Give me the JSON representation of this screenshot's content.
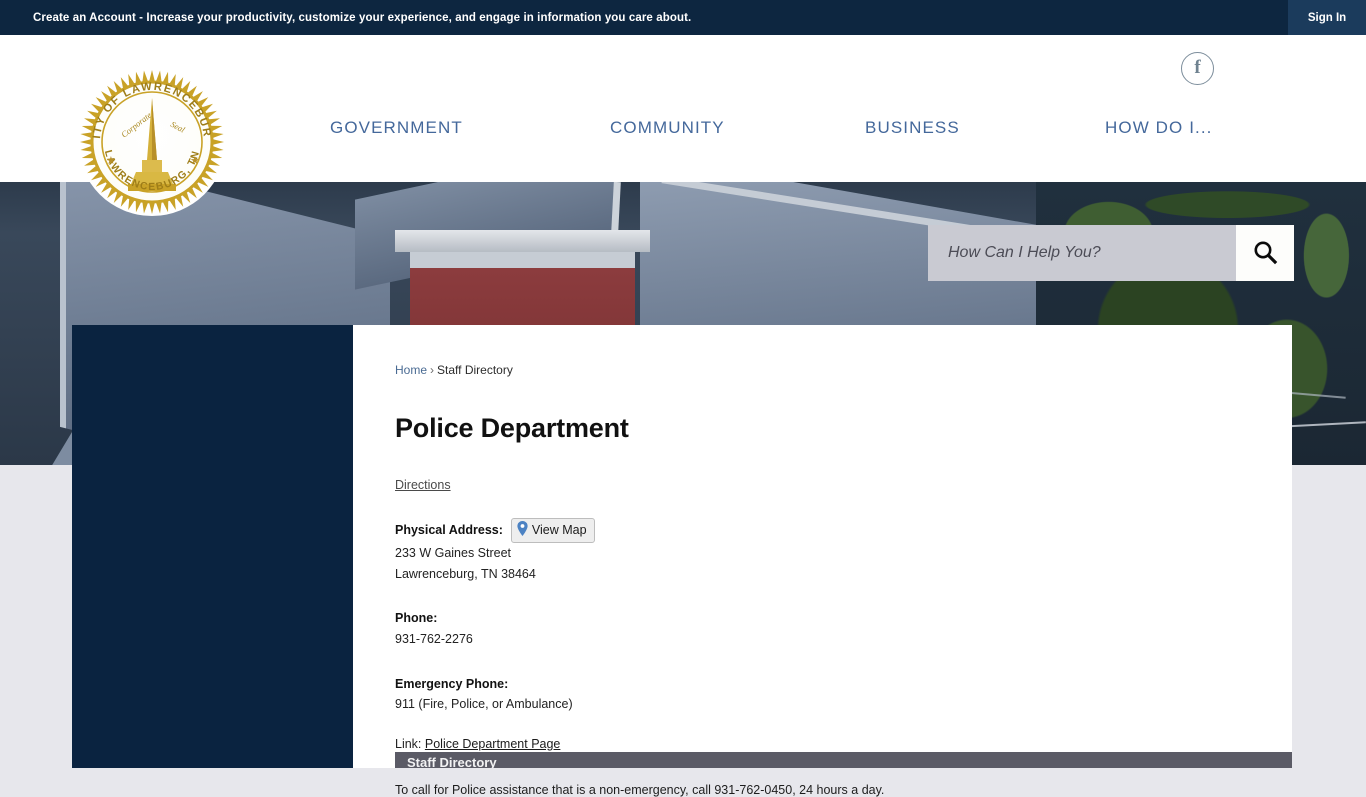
{
  "topbar": {
    "message": "Create an Account - Increase your productivity, customize your experience, and engage in information you care about.",
    "signin_label": "Sign In"
  },
  "header": {
    "logo": {
      "icon": "city-seal-logo",
      "top_arc_text": "CITY OF LAWRENCEBURG",
      "bottom_arc_text": "LAWRENCEBURG, TN",
      "script_left": "Corporate",
      "script_right": "Seal",
      "color": "#c9a227"
    },
    "social": [
      {
        "icon": "facebook-icon",
        "glyph": "f"
      }
    ],
    "nav": [
      {
        "label": "GOVERNMENT"
      },
      {
        "label": "COMMUNITY"
      },
      {
        "label": "BUSINESS"
      },
      {
        "label": "HOW DO I..."
      }
    ],
    "nav_color": "#44689b"
  },
  "search": {
    "placeholder": "How Can I Help You?",
    "value": "",
    "button_icon": "search-icon"
  },
  "breadcrumb": {
    "items": [
      {
        "label": "Home",
        "is_link": true
      },
      {
        "label": "Staff Directory",
        "is_link": false
      }
    ],
    "separator": "›"
  },
  "main": {
    "title": "Police Department",
    "directions_label": "Directions",
    "physical_address": {
      "label": "Physical Address:",
      "view_map_label": "View Map",
      "view_map_icon": "map-pin-icon",
      "line1": "233 W Gaines Street",
      "line2": "Lawrenceburg, TN 38464"
    },
    "phone": {
      "label": "Phone:",
      "value": "931-762-2276"
    },
    "emergency_phone": {
      "label": "Emergency Phone:",
      "value": "911 (Fire, Police, or Ambulance)"
    },
    "link": {
      "prefix": "Link:",
      "label": "Police Department Page"
    },
    "note": "To call for Police assistance that is a non-emergency, call 931-762-0450, 24 hours a day.",
    "section_bar_label": "Staff Directory"
  },
  "colors": {
    "topbar_bg": "#0d2640",
    "signin_bg": "#1b3b5c",
    "rail_bg": "#0a2340",
    "page_bg": "#e7e7ec",
    "panel_bg": "#ffffff",
    "search_bg": "#c9cad2",
    "section_bar_bg": "#5b5b66"
  }
}
